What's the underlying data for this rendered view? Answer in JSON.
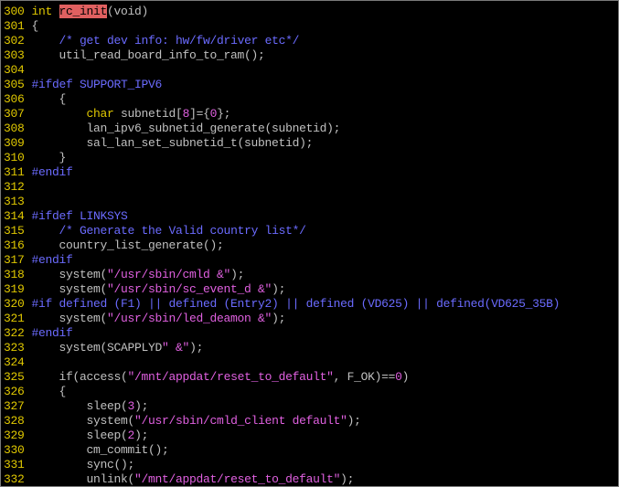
{
  "colors": {
    "background": "#000000",
    "line_number": "#e0c800",
    "plain": "#c0c0c0",
    "type": "#e0c800",
    "preproc": "#6b6bff",
    "comment": "#6b6bff",
    "string": "#e060e0",
    "number": "#e060e0",
    "search_highlight": "#e06060"
  },
  "lines": [
    {
      "num": "300",
      "tokens": [
        {
          "t": "type",
          "s": "int "
        },
        {
          "t": "hl",
          "s": "rc_init"
        },
        {
          "t": "plain",
          "s": "(void)"
        }
      ]
    },
    {
      "num": "301",
      "tokens": [
        {
          "t": "plain",
          "s": "{"
        }
      ]
    },
    {
      "num": "302",
      "tokens": [
        {
          "t": "plain",
          "s": "    "
        },
        {
          "t": "comment",
          "s": "/* get dev info: hw/fw/driver etc*/"
        }
      ]
    },
    {
      "num": "303",
      "tokens": [
        {
          "t": "plain",
          "s": "    util_read_board_info_to_ram();"
        }
      ]
    },
    {
      "num": "304",
      "tokens": []
    },
    {
      "num": "305",
      "tokens": [
        {
          "t": "preproc",
          "s": "#ifdef SUPPORT_IPV6"
        }
      ]
    },
    {
      "num": "306",
      "tokens": [
        {
          "t": "plain",
          "s": "    {"
        }
      ]
    },
    {
      "num": "307",
      "tokens": [
        {
          "t": "plain",
          "s": "        "
        },
        {
          "t": "type",
          "s": "char"
        },
        {
          "t": "plain",
          "s": " subnetid["
        },
        {
          "t": "number",
          "s": "8"
        },
        {
          "t": "plain",
          "s": "]={"
        },
        {
          "t": "number",
          "s": "0"
        },
        {
          "t": "plain",
          "s": "};"
        }
      ]
    },
    {
      "num": "308",
      "tokens": [
        {
          "t": "plain",
          "s": "        lan_ipv6_subnetid_generate(subnetid);"
        }
      ]
    },
    {
      "num": "309",
      "tokens": [
        {
          "t": "plain",
          "s": "        sal_lan_set_subnetid_t(subnetid);"
        }
      ]
    },
    {
      "num": "310",
      "tokens": [
        {
          "t": "plain",
          "s": "    }"
        }
      ]
    },
    {
      "num": "311",
      "tokens": [
        {
          "t": "preproc",
          "s": "#endif"
        }
      ]
    },
    {
      "num": "312",
      "tokens": []
    },
    {
      "num": "313",
      "tokens": []
    },
    {
      "num": "314",
      "tokens": [
        {
          "t": "preproc",
          "s": "#ifdef LINKSYS"
        }
      ]
    },
    {
      "num": "315",
      "tokens": [
        {
          "t": "plain",
          "s": "    "
        },
        {
          "t": "comment",
          "s": "/* Generate the Valid country list*/"
        }
      ]
    },
    {
      "num": "316",
      "tokens": [
        {
          "t": "plain",
          "s": "    country_list_generate();"
        }
      ]
    },
    {
      "num": "317",
      "tokens": [
        {
          "t": "preproc",
          "s": "#endif"
        }
      ]
    },
    {
      "num": "318",
      "tokens": [
        {
          "t": "plain",
          "s": "    system("
        },
        {
          "t": "string",
          "s": "\"/usr/sbin/cmld &\""
        },
        {
          "t": "plain",
          "s": ");"
        }
      ]
    },
    {
      "num": "319",
      "tokens": [
        {
          "t": "plain",
          "s": "    system("
        },
        {
          "t": "string",
          "s": "\"/usr/sbin/sc_event_d &\""
        },
        {
          "t": "plain",
          "s": ");"
        }
      ]
    },
    {
      "num": "320",
      "tokens": [
        {
          "t": "preproc",
          "s": "#if defined (F1) || defined (Entry2) || defined (VD625) || defined(VD625_35B)"
        }
      ]
    },
    {
      "num": "321",
      "tokens": [
        {
          "t": "plain",
          "s": "    system("
        },
        {
          "t": "string",
          "s": "\"/usr/sbin/led_deamon &\""
        },
        {
          "t": "plain",
          "s": ");"
        }
      ]
    },
    {
      "num": "322",
      "tokens": [
        {
          "t": "preproc",
          "s": "#endif"
        }
      ]
    },
    {
      "num": "323",
      "tokens": [
        {
          "t": "plain",
          "s": "    system(SCAPPLYD"
        },
        {
          "t": "string",
          "s": "\" &\""
        },
        {
          "t": "plain",
          "s": ");"
        }
      ]
    },
    {
      "num": "324",
      "tokens": []
    },
    {
      "num": "325",
      "tokens": [
        {
          "t": "plain",
          "s": "    if(access("
        },
        {
          "t": "string",
          "s": "\"/mnt/appdat/reset_to_default\""
        },
        {
          "t": "plain",
          "s": ", F_OK)=="
        },
        {
          "t": "number",
          "s": "0"
        },
        {
          "t": "plain",
          "s": ")"
        }
      ]
    },
    {
      "num": "326",
      "tokens": [
        {
          "t": "plain",
          "s": "    {"
        }
      ]
    },
    {
      "num": "327",
      "tokens": [
        {
          "t": "plain",
          "s": "        sleep("
        },
        {
          "t": "number",
          "s": "3"
        },
        {
          "t": "plain",
          "s": ");"
        }
      ]
    },
    {
      "num": "328",
      "tokens": [
        {
          "t": "plain",
          "s": "        system("
        },
        {
          "t": "string",
          "s": "\"/usr/sbin/cmld_client default\""
        },
        {
          "t": "plain",
          "s": ");"
        }
      ]
    },
    {
      "num": "329",
      "tokens": [
        {
          "t": "plain",
          "s": "        sleep("
        },
        {
          "t": "number",
          "s": "2"
        },
        {
          "t": "plain",
          "s": ");"
        }
      ]
    },
    {
      "num": "330",
      "tokens": [
        {
          "t": "plain",
          "s": "        cm_commit();"
        }
      ]
    },
    {
      "num": "331",
      "tokens": [
        {
          "t": "plain",
          "s": "        sync();"
        }
      ]
    },
    {
      "num": "332",
      "tokens": [
        {
          "t": "plain",
          "s": "        unlink("
        },
        {
          "t": "string",
          "s": "\"/mnt/appdat/reset_to_default\""
        },
        {
          "t": "plain",
          "s": ");"
        }
      ]
    }
  ]
}
